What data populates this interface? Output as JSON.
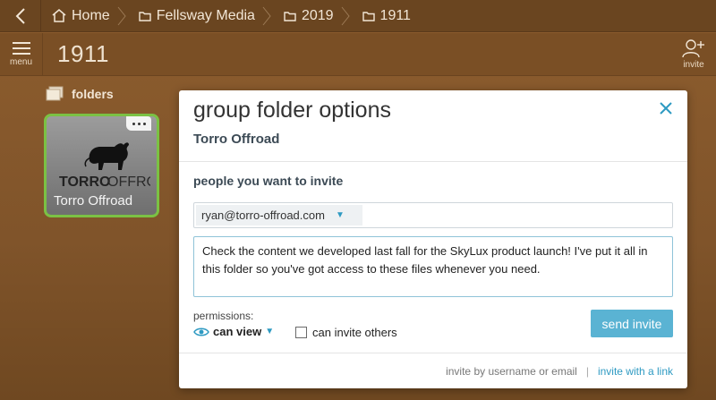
{
  "breadcrumb": {
    "items": [
      {
        "label": "Home",
        "icon": "home-icon"
      },
      {
        "label": "Fellsway Media",
        "icon": "folder-icon"
      },
      {
        "label": "2019",
        "icon": "folder-icon"
      },
      {
        "label": "1911",
        "icon": "folder-icon"
      }
    ]
  },
  "header": {
    "menu_label": "menu",
    "title": "1911",
    "invite_label": "invite"
  },
  "folders": {
    "heading": "folders",
    "items": [
      {
        "name": "Torro Offroad",
        "logo_text": "TORROOFFROAD",
        "selected": true
      }
    ]
  },
  "modal": {
    "title": "group folder options",
    "folder_name": "Torro Offroad",
    "section_title": "people you want to invite",
    "recipient": "ryan@torro-offroad.com",
    "message": "Check the content we developed last fall for the SkyLux product launch! I've put it all in this folder so you've got access to these files whenever you need.",
    "permissions_label": "permissions:",
    "permission_value": "can view",
    "can_invite_label": "can invite others",
    "can_invite_checked": false,
    "send_label": "send invite",
    "footer": {
      "invite_by_username": "invite by username or email",
      "divider": "|",
      "invite_with_link": "invite with a link"
    }
  },
  "colors": {
    "accent": "#5ab3d3",
    "link": "#2e9ac2",
    "selected_border": "#7bc144",
    "background": "#8a5a2b"
  }
}
